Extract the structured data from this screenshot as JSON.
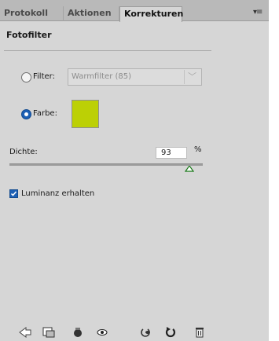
{
  "tabs": [
    {
      "label": "Protokoll",
      "active": false
    },
    {
      "label": "Aktionen",
      "active": false
    },
    {
      "label": "Korrekturen",
      "active": true
    }
  ],
  "panel_menu_icon": "panel-menu-icon",
  "title": "Fotofilter",
  "filter": {
    "radio_label": "Filter:",
    "selected": false,
    "dropdown_value": "Warmfilter (85)"
  },
  "color": {
    "radio_label": "Farbe:",
    "selected": true,
    "swatch_hex": "#bcd005"
  },
  "density": {
    "label": "Dichte:",
    "value": "93",
    "unit": "%",
    "slider_fraction": 0.93
  },
  "luminance": {
    "label": "Luminanz erhalten",
    "checked": true
  },
  "footer_icons": [
    "back-arrow-icon",
    "clip-to-layer-icon",
    "visibility-toggle-icon",
    "view-previous-state-icon",
    "reset-icon",
    "reset-to-default-icon",
    "delete-icon"
  ],
  "colors": {
    "panel_bg": "#d6d6d6",
    "tabbar_bg": "#b9b9b9",
    "accent_blue": "#1c5fb4"
  }
}
